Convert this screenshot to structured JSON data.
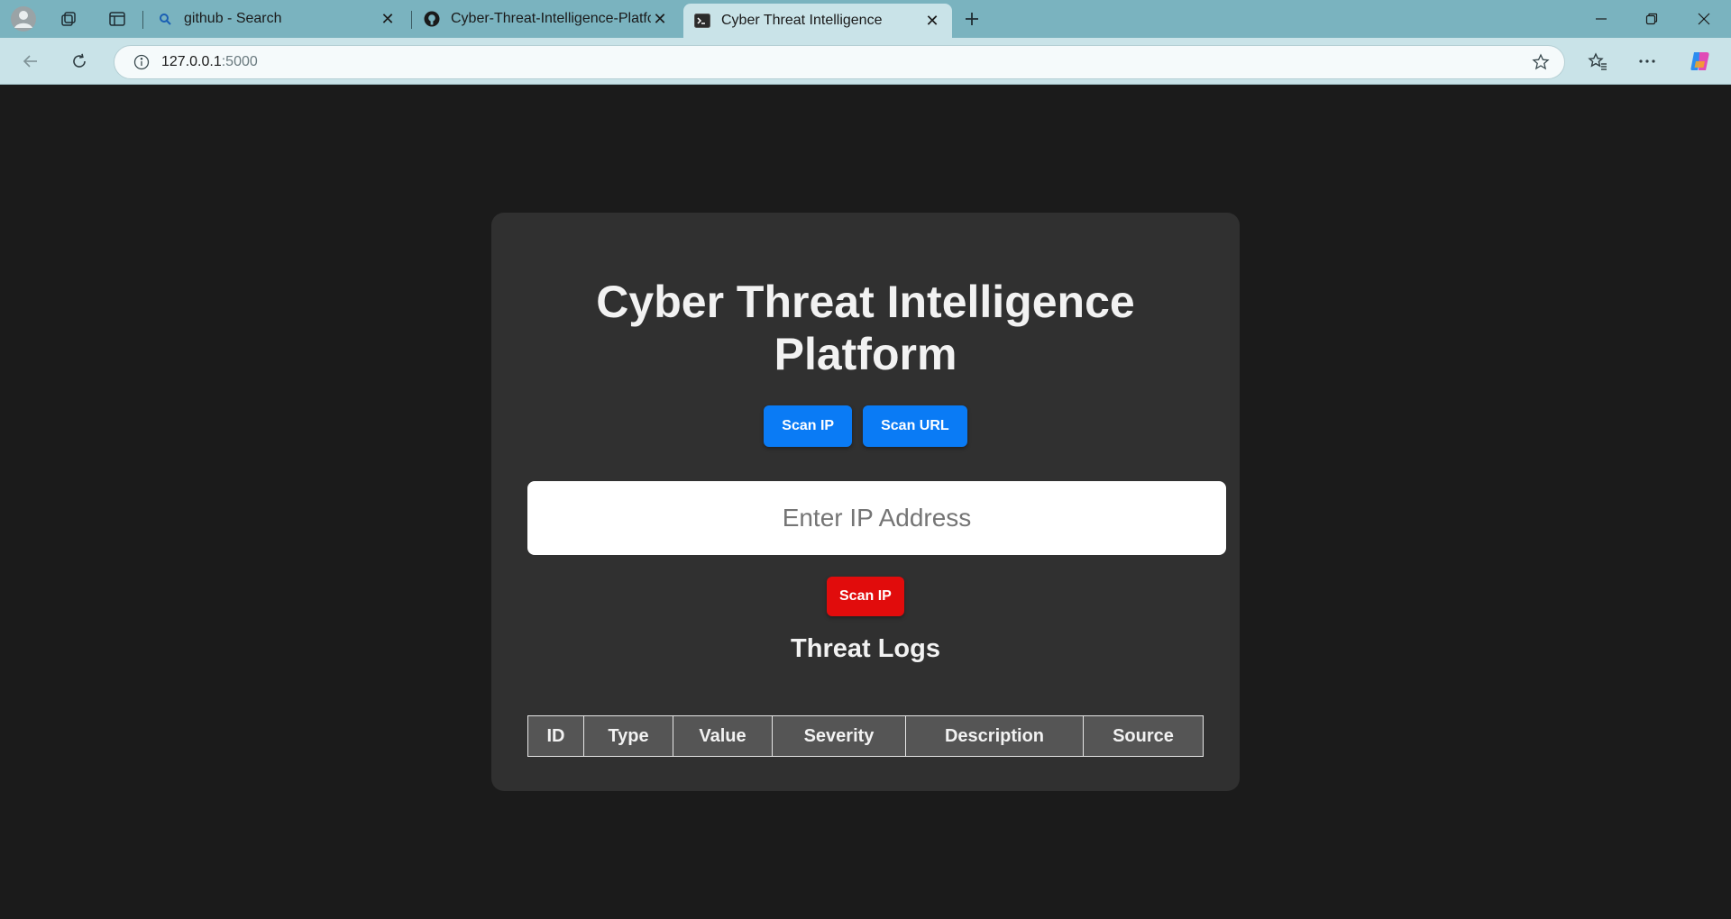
{
  "browser": {
    "tabs": [
      {
        "title": "github - Search",
        "icon": "search-icon"
      },
      {
        "title": "Cyber-Threat-Intelligence-Platform",
        "icon": "github-icon"
      },
      {
        "title": "Cyber Threat Intelligence",
        "icon": "terminal-icon",
        "active": true
      }
    ],
    "url": {
      "host": "127.0.0.1",
      "port": ":5000"
    }
  },
  "page": {
    "title_line1": "Cyber Threat Intelligence",
    "title_line2": "Platform",
    "scan_ip_tab_label": "Scan IP",
    "scan_url_tab_label": "Scan URL",
    "input_placeholder": "Enter IP Address",
    "scan_button_label": "Scan IP",
    "logs_heading": "Threat Logs",
    "table_columns": [
      "ID",
      "Type",
      "Value",
      "Severity",
      "Description",
      "Source"
    ]
  },
  "colors": {
    "page_bg": "#1b1b1b",
    "card_bg": "#303030",
    "primary": "#0a7bf5",
    "danger": "#e10c0c",
    "tabbar": "#7ab3bf"
  }
}
